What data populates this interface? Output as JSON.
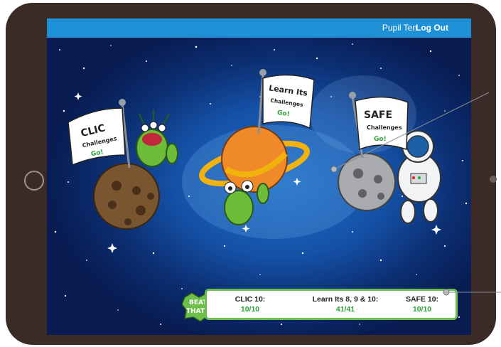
{
  "header": {
    "user_name": "Pupil Ten",
    "logout_label": "Log Out"
  },
  "challenges": [
    {
      "title": "CLIC",
      "subtitle": "Challenges",
      "go": "Go!"
    },
    {
      "title": "Learn Its",
      "subtitle": "Challenges",
      "go": "Go!"
    },
    {
      "title": "SAFE",
      "subtitle": "Challenges",
      "go": "Go!"
    }
  ],
  "badge": {
    "line1": "BEAT",
    "line2": "THAT!"
  },
  "scores": [
    {
      "label": "CLIC 10:",
      "value": "10/10"
    },
    {
      "label": "Learn Its 8, 9 & 10:",
      "value": "41/41"
    },
    {
      "label": "SAFE 10:",
      "value": "10/10"
    }
  ],
  "colors": {
    "topbar": "#1e90d5",
    "score_border": "#6cc04a",
    "score_value": "#2aa336",
    "tablet_frame": "#3b2a27"
  }
}
